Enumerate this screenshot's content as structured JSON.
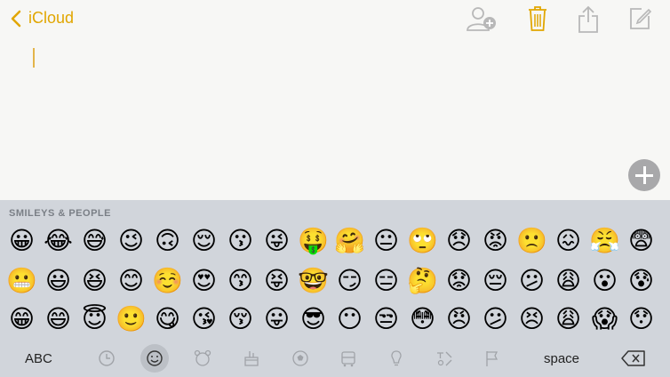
{
  "nav": {
    "back_label": "iCloud"
  },
  "keyboard": {
    "section_title": "SMILEYS & PEOPLE",
    "rows": [
      [
        "😀",
        "😂",
        "😅",
        "😉",
        "🙃",
        "😌",
        "😗",
        "😜",
        "🤑",
        "🤗",
        "😐",
        "🙄",
        "😞",
        "😡",
        "🙁",
        "😖",
        "😤",
        "😨"
      ],
      [
        "😬",
        "😃",
        "😆",
        "😊",
        "☺️",
        "😍",
        "😙",
        "😝",
        "🤓",
        "😏",
        "😑",
        "🤔",
        "😟",
        "😔",
        "😕",
        "😩",
        "😮",
        "😰"
      ],
      [
        "😁",
        "😄",
        "😇",
        "🙂",
        "😋",
        "😘",
        "😚",
        "😛",
        "😎",
        "😶",
        "😒",
        "😳",
        "😠",
        "😕",
        "😣",
        "😩",
        "😱",
        "😯"
      ]
    ],
    "abc_label": "ABC",
    "space_label": "space"
  },
  "colors": {
    "accent": "#e1a600",
    "keyboard_bg": "#d1d5db",
    "icon_gray": "#a0a3a8"
  }
}
